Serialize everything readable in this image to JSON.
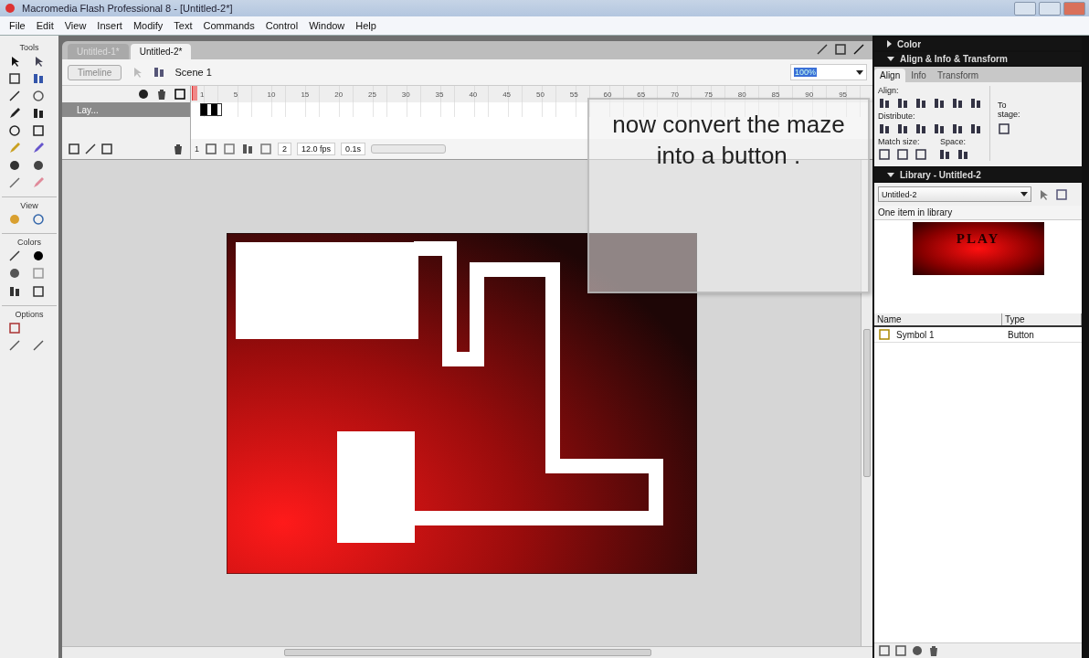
{
  "window": {
    "title": "Macromedia Flash Professional 8 - [Untitled-2*]"
  },
  "menu": [
    "File",
    "Edit",
    "View",
    "Insert",
    "Modify",
    "Text",
    "Commands",
    "Control",
    "Window",
    "Help"
  ],
  "tools": {
    "title": "Tools",
    "view_title": "View",
    "colors_title": "Colors",
    "options_title": "Options"
  },
  "document_tabs": [
    {
      "label": "Untitled-1*",
      "selected": false
    },
    {
      "label": "Untitled-2*",
      "selected": true
    }
  ],
  "edit_bar": {
    "timeline_button": "Timeline",
    "scene": "Scene 1",
    "zoom": "100%"
  },
  "timeline": {
    "frame_numbers": [
      "1",
      "5",
      "10",
      "15",
      "20",
      "25",
      "30",
      "35",
      "40",
      "45",
      "50",
      "55",
      "60",
      "65",
      "70",
      "75",
      "80",
      "85",
      "90",
      "95"
    ],
    "layers": [
      {
        "name": "Lay...",
        "selected": true
      }
    ],
    "current_frame": "1",
    "frame_field": "2",
    "frame_rate": "12.0 fps",
    "elapsed": "0.1s"
  },
  "caption": "now convert the maze into a button .",
  "panels": {
    "color": {
      "title": "Color",
      "expanded": false
    },
    "align": {
      "title": "Align & Info & Transform",
      "expanded": true,
      "tabs": [
        {
          "label": "Align",
          "selected": true
        },
        {
          "label": "Info",
          "selected": false
        },
        {
          "label": "Transform",
          "selected": false
        }
      ],
      "align_label": "Align:",
      "distribute_label": "Distribute:",
      "match_label": "Match size:",
      "space_label": "Space:",
      "to_stage": "To stage:"
    },
    "library": {
      "title": "Library - Untitled-2",
      "expanded": true,
      "document": "Untitled-2",
      "count": "One item in library",
      "preview": "PLAY",
      "columns": [
        "Name",
        "Type"
      ],
      "items": [
        {
          "name": "Symbol 1",
          "type": "Button",
          "selected": false
        }
      ]
    }
  }
}
